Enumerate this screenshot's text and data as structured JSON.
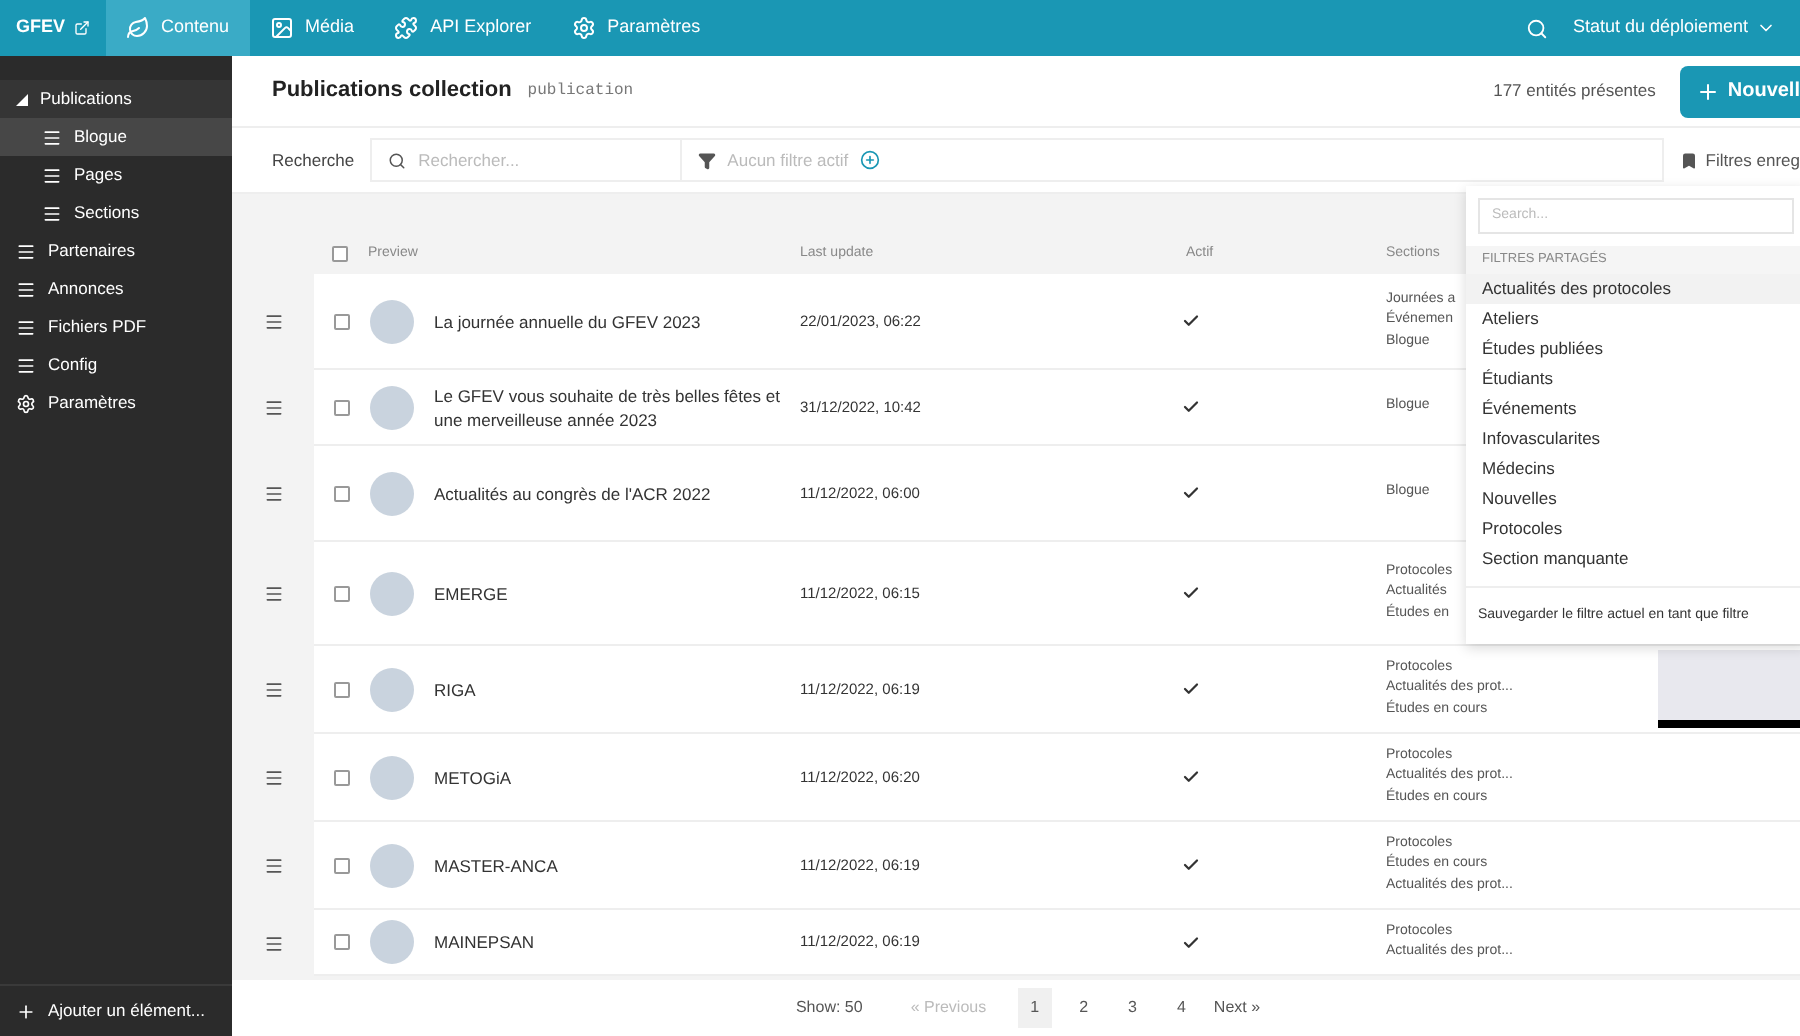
{
  "topbar": {
    "brand": "GFEV",
    "nav": [
      {
        "label": "Contenu",
        "selected": true
      },
      {
        "label": "Média",
        "selected": false
      },
      {
        "label": "API Explorer",
        "selected": false
      },
      {
        "label": "Paramètres",
        "selected": false
      }
    ],
    "status_menu": "Statut du déploiement"
  },
  "sidebar": {
    "items": [
      {
        "label": "Publications",
        "kind": "group",
        "expanded": true,
        "selected": false,
        "children": [
          {
            "label": "Blogue",
            "selected": true
          },
          {
            "label": "Pages",
            "selected": false
          },
          {
            "label": "Sections",
            "selected": false
          }
        ]
      },
      {
        "label": "Partenaires",
        "kind": "collection",
        "selected": false
      },
      {
        "label": "Annonces",
        "kind": "collection",
        "selected": false
      },
      {
        "label": "Fichiers PDF",
        "kind": "collection",
        "selected": false
      },
      {
        "label": "Config",
        "kind": "collection",
        "selected": false
      },
      {
        "label": "Paramètres",
        "kind": "settings",
        "selected": false
      }
    ],
    "add_button": "Ajouter un élément..."
  },
  "header": {
    "title": "Publications collection",
    "slug": "publication",
    "count": "177 entités présentes",
    "new_button": "Nouvell"
  },
  "search_bar": {
    "label": "Recherche",
    "placeholder": "Rechercher...",
    "filter_text": "Aucun filtre actif",
    "saved_filters": "Filtres enreg"
  },
  "table": {
    "select_all_checked": false,
    "columns": [
      "Preview",
      "Last update",
      "Actif",
      "Sections"
    ],
    "rows": [
      {
        "title": "La journée annuelle du GFEV 2023",
        "updated": "22/01/2023, 06:22",
        "active": true,
        "checked": false,
        "sections": [
          "Journées a",
          "Événemen",
          "Blogue"
        ]
      },
      {
        "title": "Le GFEV vous souhaite de très belles fêtes et une merveilleuse année 2023",
        "updated": "31/12/2022, 10:42",
        "active": true,
        "checked": false,
        "sections": [
          "Blogue"
        ]
      },
      {
        "title": "Actualités au congrès de l'ACR 2022",
        "updated": "11/12/2022, 06:00",
        "active": true,
        "checked": false,
        "sections": [
          "Blogue"
        ]
      },
      {
        "title": "EMERGE",
        "updated": "11/12/2022, 06:15",
        "active": true,
        "checked": false,
        "sections": [
          "Protocoles",
          "Actualités",
          "Études en"
        ]
      },
      {
        "title": "RIGA",
        "updated": "11/12/2022, 06:19",
        "active": true,
        "checked": false,
        "sections": [
          "Protocoles",
          "Actualités des prot...",
          "Études en cours"
        ],
        "preview_image": true
      },
      {
        "title": "METOGiA",
        "updated": "11/12/2022, 06:20",
        "active": true,
        "checked": false,
        "sections": [
          "Protocoles",
          "Actualités des prot...",
          "Études en cours"
        ]
      },
      {
        "title": "MASTER-ANCA",
        "updated": "11/12/2022, 06:19",
        "active": true,
        "checked": false,
        "sections": [
          "Protocoles",
          "Études en cours",
          "Actualités des prot..."
        ]
      },
      {
        "title": "MAINEPSAN",
        "updated": "11/12/2022, 06:19",
        "active": true,
        "checked": false,
        "sections": [
          "Protocoles",
          "Actualités des prot..."
        ]
      }
    ]
  },
  "filter_menu": {
    "placeholder": "Search...",
    "group": "FILTRES PARTAGÉS",
    "items": [
      {
        "label": "Actualités des protocoles",
        "selected": true
      },
      {
        "label": "Ateliers",
        "selected": false
      },
      {
        "label": "Études publiées",
        "selected": false
      },
      {
        "label": "Étudiants",
        "selected": false
      },
      {
        "label": "Événements",
        "selected": false
      },
      {
        "label": "Infovascularites",
        "selected": false
      },
      {
        "label": "Médecins",
        "selected": false
      },
      {
        "label": "Nouvelles",
        "selected": false
      },
      {
        "label": "Protocoles",
        "selected": false
      },
      {
        "label": "Section manquante",
        "selected": false
      }
    ],
    "save": "Sauvegarder le filtre actuel en tant que filtre"
  },
  "pagination": {
    "show": "Show: 50",
    "previous": "« Previous",
    "next": "Next »",
    "pages": [
      {
        "label": "1",
        "selected": true
      },
      {
        "label": "2",
        "selected": false
      },
      {
        "label": "3",
        "selected": false
      },
      {
        "label": "4",
        "selected": false
      }
    ]
  }
}
